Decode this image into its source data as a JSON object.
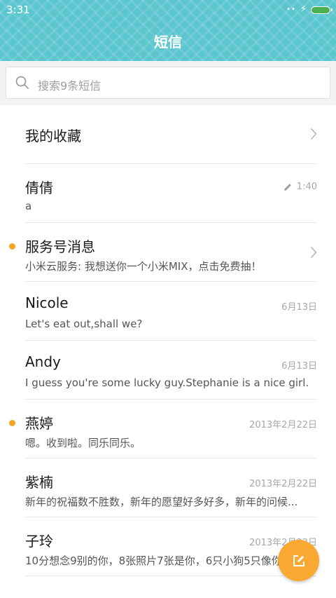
{
  "status_bar": {
    "time": "3:31",
    "signal_dots": "••",
    "charging_glyph": "⚡"
  },
  "header": {
    "title": "短信"
  },
  "search": {
    "placeholder": "搜索9条短信"
  },
  "favorites": {
    "label": "我的收藏"
  },
  "conversations": [
    {
      "name": "倩倩",
      "preview": "a",
      "time": "1:40",
      "draft": true,
      "unread": false
    },
    {
      "name": "服务号消息",
      "preview": "小米云服务: 我想送你一个小米MIX，点击免费抽！",
      "time": "",
      "unread": true,
      "has_chevron": true
    },
    {
      "name": "Nicole",
      "preview": "Let's eat out,shall we?",
      "time": "6月13日",
      "unread": false
    },
    {
      "name": "Andy",
      "preview": "I guess you're some lucky guy.Stephanie is a nice girl.",
      "time": "6月13日",
      "unread": false
    },
    {
      "name": "燕婷",
      "preview": "嗯。收到啦。同乐同乐。",
      "time": "2013年2月22日",
      "unread": true
    },
    {
      "name": "紫楠",
      "preview": "新年的祝福数不胜数，新年的愿望好多好多，新年的问候...",
      "time": "2013年2月22日",
      "unread": false
    },
    {
      "name": "子玲",
      "preview": "10分想念9别的你，8张照片7张是你，6只小狗5只像你",
      "time": "2013年2月22日",
      "unread": false
    }
  ],
  "colors": {
    "header": "#5cc6cf",
    "accent": "#f9a832",
    "unread_dot": "#f5a623",
    "battery": "#4caf50"
  },
  "icons": {
    "search": "search-icon",
    "chevron": "chevron-right-icon",
    "draft": "pencil-icon",
    "compose": "compose-icon"
  }
}
